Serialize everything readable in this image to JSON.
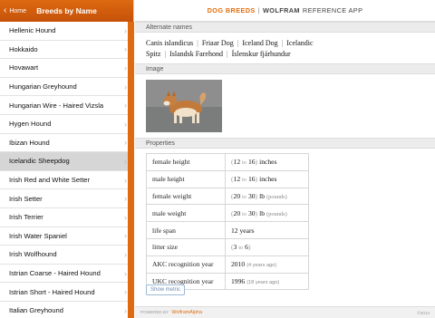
{
  "left": {
    "home_label": "Home",
    "title": "Breeds by Name",
    "items": [
      {
        "label": "Hellenic Hound"
      },
      {
        "label": "Hokkaido"
      },
      {
        "label": "Hovawart"
      },
      {
        "label": "Hungarian Greyhound"
      },
      {
        "label": "Hungarian Wire - Haired Vizsla"
      },
      {
        "label": "Hygen Hound"
      },
      {
        "label": "Ibizan Hound"
      },
      {
        "label": "Icelandic Sheepdog"
      },
      {
        "label": "Irish Red and White Setter"
      },
      {
        "label": "Irish Setter"
      },
      {
        "label": "Irish Terrier"
      },
      {
        "label": "Irish Water Spaniel"
      },
      {
        "label": "Irish Wolfhound"
      },
      {
        "label": "Istrian Coarse - Haired Hound"
      },
      {
        "label": "Istrian Short - Haired Hound"
      },
      {
        "label": "Italian Greyhound"
      }
    ],
    "selected_index": 7
  },
  "header": {
    "brand": "DOG BREEDS",
    "separator": "|",
    "wolfram": "WOLFRAM",
    "rest": "REFERENCE APP"
  },
  "sections": {
    "alternate_names": "Alternate names",
    "image": "Image",
    "properties": "Properties"
  },
  "alternate_names": {
    "line1": [
      "Canis islandicus",
      "Friaar Dog",
      "Iceland Dog",
      "Icelandic"
    ],
    "line2": [
      "Spitz",
      "Islandsk Farehond",
      "Íslenskur fjárhundur"
    ],
    "separator": "|"
  },
  "properties": [
    {
      "name": "female height",
      "open": "(",
      "a": "12",
      "to": "to",
      "b": "16",
      "close": ")",
      "unit": "inches",
      "unit_style": "dark",
      "note": ""
    },
    {
      "name": "male height",
      "open": "(",
      "a": "12",
      "to": "to",
      "b": "16",
      "close": ")",
      "unit": "inches",
      "unit_style": "dark",
      "note": ""
    },
    {
      "name": "female weight",
      "open": "(",
      "a": "20",
      "to": "to",
      "b": "30",
      "close": ")",
      "unit": "lb",
      "unit2": "(pounds)",
      "unit_style": "dark",
      "note": ""
    },
    {
      "name": "male weight",
      "open": "(",
      "a": "20",
      "to": "to",
      "b": "30",
      "close": ")",
      "unit": "lb",
      "unit2": "(pounds)",
      "unit_style": "dark",
      "note": ""
    },
    {
      "name": "life span",
      "value": "12 years"
    },
    {
      "name": "litter size",
      "open": "(",
      "a": "3",
      "to": "to",
      "b": "6",
      "close": ")",
      "unit": ""
    },
    {
      "name": "AKC recognition year",
      "value": "2010",
      "sub": "(4 years ago)"
    },
    {
      "name": "UKC recognition year",
      "value": "1996",
      "sub": "(18 years ago)"
    }
  ],
  "show_metric_label": "Show metric",
  "footer": {
    "powered": "POWERED BY",
    "wa": "WolframAlpha",
    "copyright": "©2014"
  },
  "colors": {
    "accent": "#e36c0a",
    "header_orange": "#d35f0c",
    "selected_row": "#d6d6d6"
  }
}
